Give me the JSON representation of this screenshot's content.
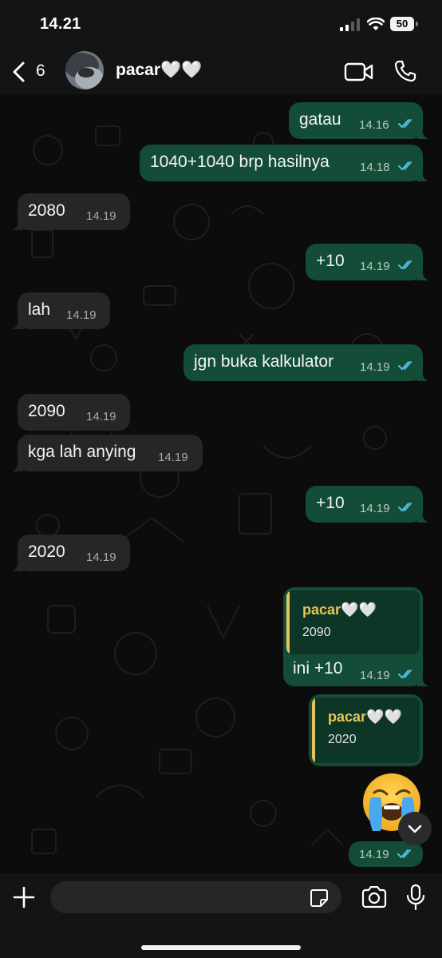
{
  "status_bar": {
    "time": "14.21",
    "battery": "50"
  },
  "header": {
    "back_count": "6",
    "contact_name": "pacar🤍🤍"
  },
  "messages": [
    {
      "dir": "out",
      "text": "gatau",
      "time": "14.16",
      "read": true
    },
    {
      "dir": "out",
      "text": "1040+1040 brp hasilnya",
      "time": "14.18",
      "read": true
    },
    {
      "dir": "in",
      "text": "2080",
      "time": "14.19"
    },
    {
      "dir": "out",
      "text": "+10",
      "time": "14.19",
      "read": true
    },
    {
      "dir": "in",
      "text": "lah",
      "time": "14.19"
    },
    {
      "dir": "out",
      "text": "jgn buka kalkulator",
      "time": "14.19",
      "read": true
    },
    {
      "dir": "in",
      "text": "2090",
      "time": "14.19"
    },
    {
      "dir": "in",
      "text": "kga lah anying",
      "time": "14.19"
    },
    {
      "dir": "out",
      "text": "+10",
      "time": "14.19",
      "read": true
    },
    {
      "dir": "in",
      "text": "2020",
      "time": "14.19"
    },
    {
      "dir": "out",
      "quote_name": "pacar🤍🤍",
      "quote_text": "2090",
      "text": "ini +10",
      "time": "14.19",
      "read": true
    },
    {
      "dir": "out",
      "quote_name": "pacar🤍🤍",
      "quote_text": "2020",
      "text": "",
      "time": "",
      "read": false
    },
    {
      "dir": "out",
      "emoji": "crying-face",
      "text": "",
      "time": "14.19",
      "read": true
    }
  ],
  "composer": {
    "placeholder": ""
  },
  "colors": {
    "outgoing_bubble": "#144d37",
    "incoming_bubble": "#262628",
    "read_ticks": "#53bdeb",
    "quote_accent": "#e6c45c"
  },
  "icons": [
    "chevron-left-icon",
    "video-icon",
    "phone-icon",
    "plus-icon",
    "sticker-icon",
    "camera-icon",
    "mic-icon",
    "chevron-down-icon",
    "double-check-icon"
  ]
}
